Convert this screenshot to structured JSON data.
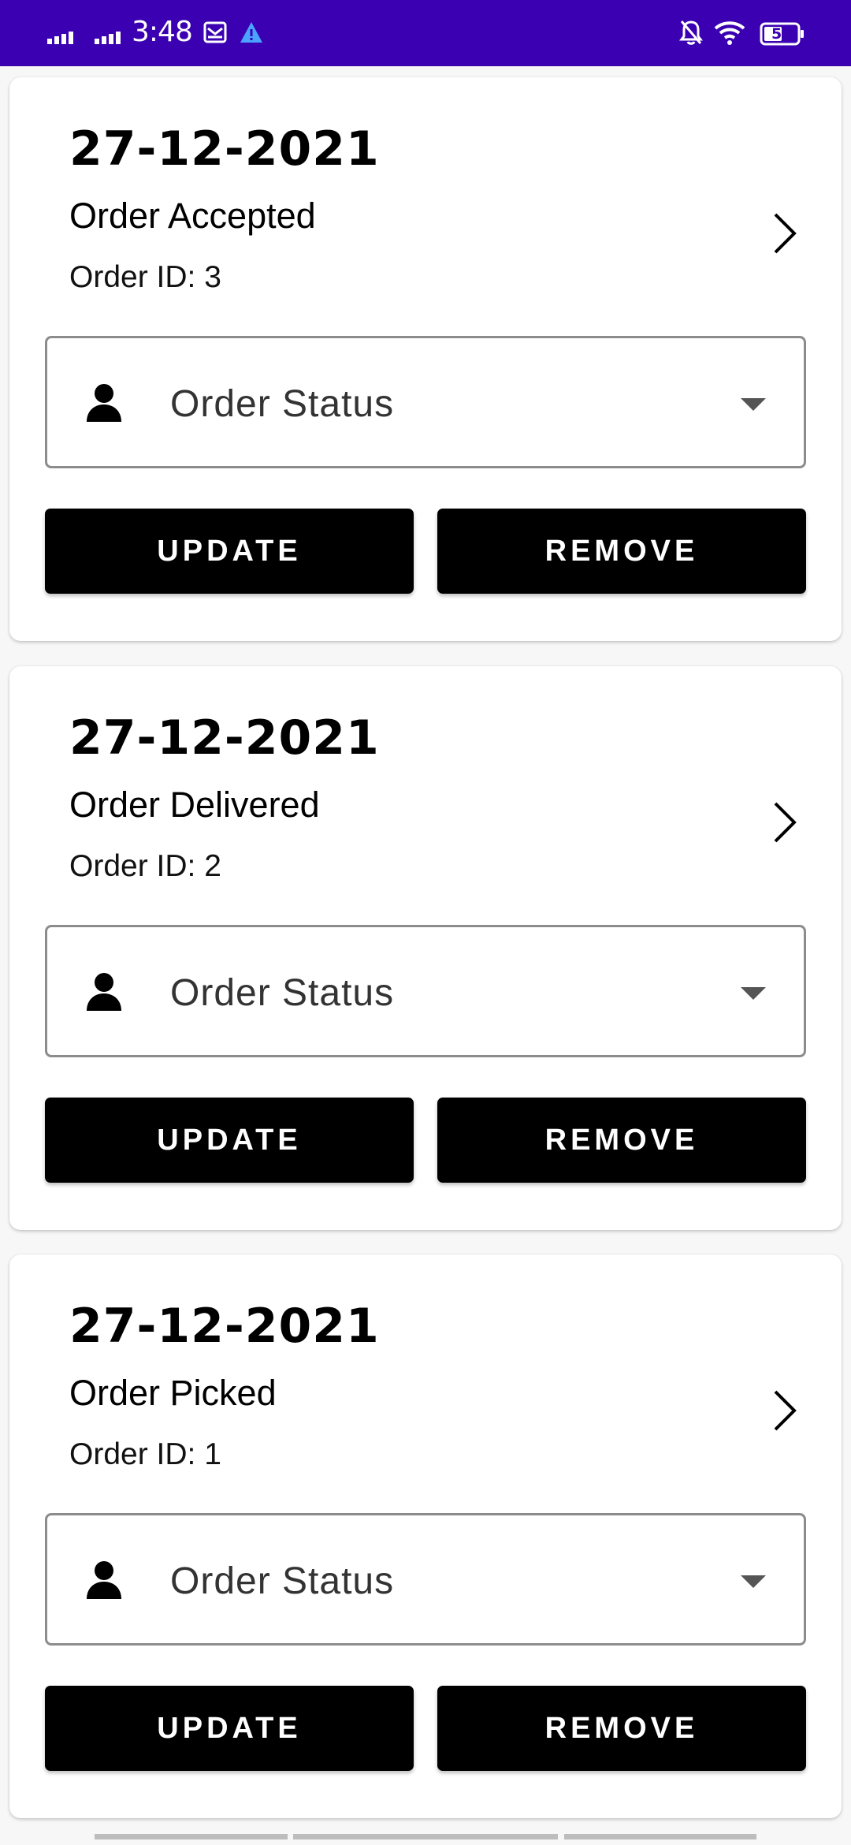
{
  "status_bar": {
    "time": "3:48",
    "battery": "50",
    "background": "#3a00b1"
  },
  "orders": [
    {
      "date": "27-12-2021",
      "status": "Order Accepted",
      "order_id": "Order ID: 3",
      "dropdown_label": "Order Status",
      "update_label": "UPDATE",
      "remove_label": "REMOVE"
    },
    {
      "date": "27-12-2021",
      "status": "Order Delivered",
      "order_id": "Order ID: 2",
      "dropdown_label": "Order Status",
      "update_label": "UPDATE",
      "remove_label": "REMOVE"
    },
    {
      "date": "27-12-2021",
      "status": "Order Picked",
      "order_id": "Order ID: 1",
      "dropdown_label": "Order Status",
      "update_label": "UPDATE",
      "remove_label": "REMOVE"
    }
  ],
  "icons": {
    "status_bar": [
      "signal-icon",
      "signal-icon",
      "mail-icon",
      "warning-icon",
      "notifications-off-icon",
      "wifi-icon",
      "battery-icon"
    ],
    "card": [
      "chevron-right-icon",
      "person-icon",
      "caret-down-icon"
    ]
  }
}
